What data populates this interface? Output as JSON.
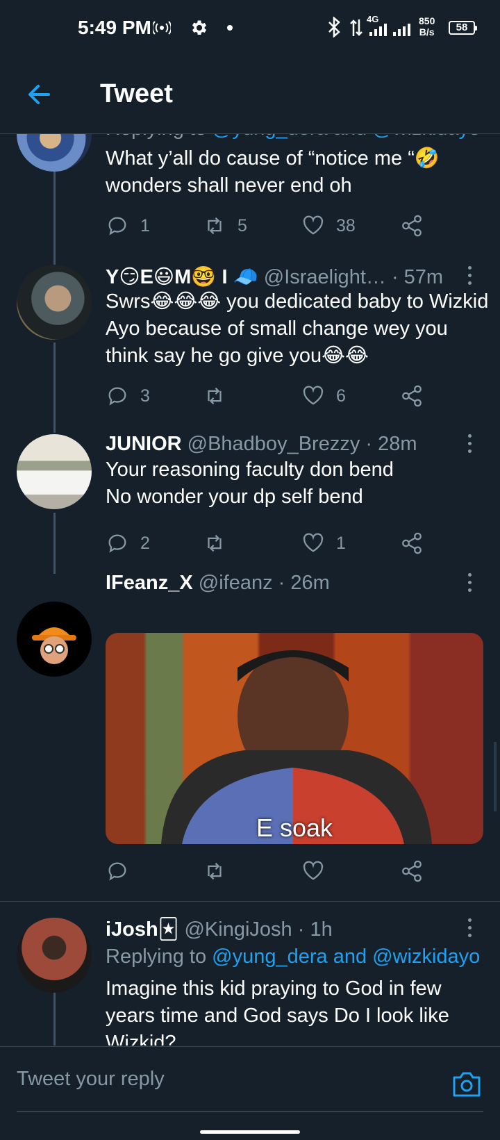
{
  "status_bar": {
    "time": "5:49 PM",
    "network_type": "4G",
    "speed_value": "850",
    "speed_unit": "B/s",
    "battery": "58"
  },
  "header": {
    "title": "Tweet"
  },
  "tweets": [
    {
      "replying_prefix": "Replying to",
      "replying_to": "@yung_dera and @wizkidayo",
      "text": "What y’all do cause of “notice me “🤣 wonders shall never end oh",
      "replies": "1",
      "retweets": "5",
      "likes": "38"
    },
    {
      "display_name": "Y😏E😃M🤓 I 🧢",
      "handle": "@Israelight…",
      "time": "· 57m",
      "text": "Swrs😂😂😂 you dedicated baby to Wizkid Ayo because of small change wey you think say he go give you😂😂",
      "replies": "3",
      "retweets": "",
      "likes": "6"
    },
    {
      "display_name": "JUNIOR",
      "handle": "@Bhadboy_Brezzy",
      "time": "· 28m",
      "text": "Your reasoning faculty don bend\nNo wonder your dp self bend",
      "replies": "2",
      "retweets": "",
      "likes": "1"
    },
    {
      "display_name": "IFeanz_X",
      "handle": "@ifeanz",
      "time": "· 26m",
      "media_caption": "E soak",
      "replies": "",
      "retweets": "",
      "likes": ""
    },
    {
      "display_name": "iJosh🃏",
      "handle": "@KingiJosh",
      "time": "· 1h",
      "replying_prefix": "Replying to",
      "replying_to": "@yung_dera and @wizkidayo",
      "text": "Imagine this kid praying to God in few years time and God says Do I look like Wizkid?"
    }
  ],
  "composer": {
    "placeholder": "Tweet your reply"
  },
  "colors": {
    "accent": "#1da1f2",
    "background": "#15202b",
    "muted": "#8899a6",
    "divider": "#38444d"
  }
}
